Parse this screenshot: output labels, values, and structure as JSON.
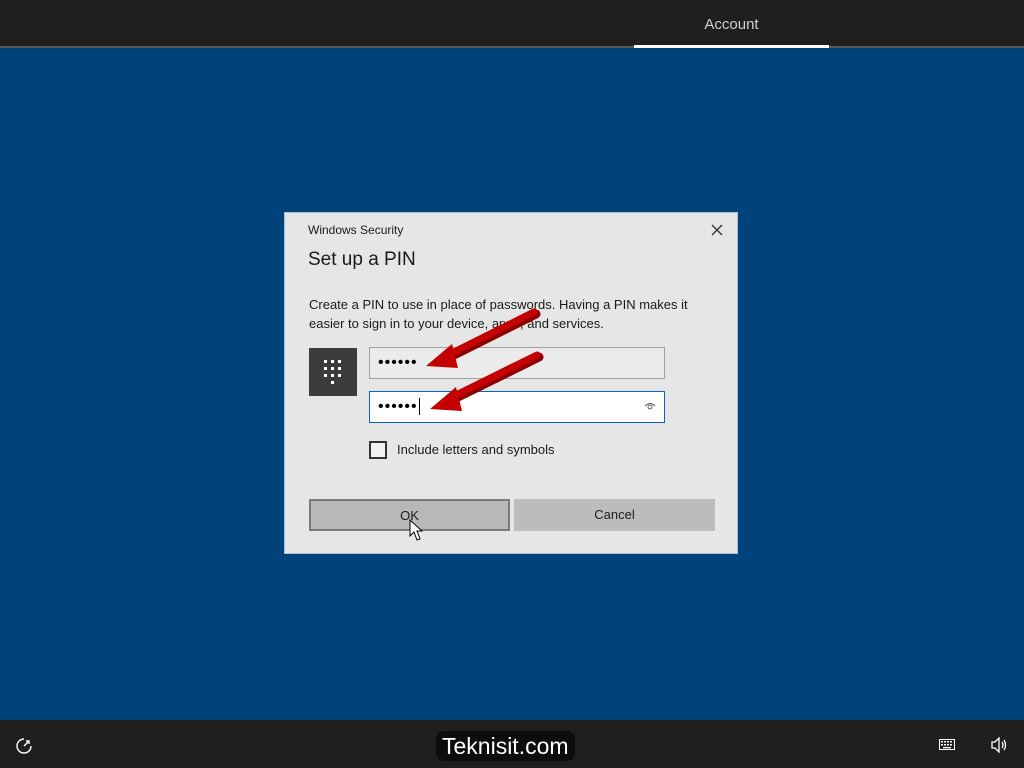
{
  "top_bar": {
    "tab_label": "Account"
  },
  "dialog": {
    "caption": "Windows Security",
    "heading": "Set up a PIN",
    "description": "Create a PIN to use in place of passwords. Having a PIN makes it easier to sign in to your device, apps, and services.",
    "pin_value": "••••••",
    "confirm_pin_value": "••••••",
    "include_letters_label": "Include letters and symbols",
    "include_letters_checked": false,
    "ok_label": "OK",
    "cancel_label": "Cancel"
  },
  "bottom_bar": {
    "watermark": "Teknisit.com",
    "icons": [
      "ease-of-access-icon",
      "keyboard-icon",
      "volume-icon"
    ]
  },
  "annotations": {
    "arrow_color": "#c00000"
  }
}
